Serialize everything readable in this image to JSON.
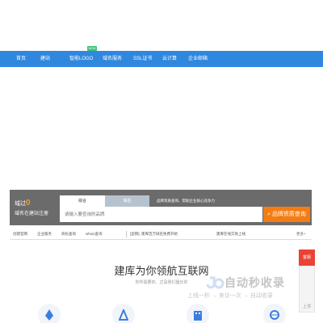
{
  "nav": {
    "items": [
      "首页",
      "建站",
      "智能LOGO",
      "域名服务",
      "SSL证书",
      "云计算",
      "企业邮箱"
    ],
    "badge": "NEW",
    "color": "#2f87de"
  },
  "hero": {
    "slogan_prefix": "域过",
    "slogan_number": "0",
    "slogan_sub": "域名在建站注册"
  },
  "search": {
    "tabs": [
      "综合",
      "域名"
    ],
    "hint": "品牌资质查询、帮助企业核心竞争力",
    "placeholder": "请输入要查询的品牌",
    "button_label": "品牌资质查询",
    "button_icon": "search-icon",
    "accent": "#f57c12"
  },
  "quicklinks": {
    "items": [
      "创建官网",
      "企业服务",
      "商标查询",
      "whois查询",
      "[促销]: 建库百万域名免费开始",
      "建库在线交易上线",
      "更多+"
    ]
  },
  "sidebar": {
    "red_label": "客服",
    "top_label": "上顶"
  },
  "section": {
    "headline": "建库为你领航互联网",
    "subline": "你所需要的，正是我们擅长的"
  },
  "watermark": {
    "brand": "自动秒收录",
    "slogan": "上线一秒 → 来访一次 → 自动收录"
  },
  "features": {
    "icons": [
      "pen-icon",
      "triangle-icon",
      "building-icon",
      "globe-icon"
    ]
  }
}
